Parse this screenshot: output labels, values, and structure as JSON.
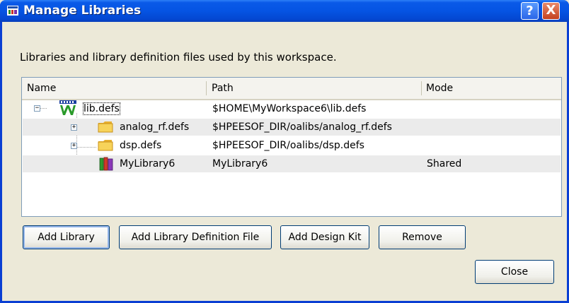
{
  "window": {
    "title": "Manage Libraries",
    "help_label": "?",
    "close_label": "X"
  },
  "description": "Libraries and library definition files used by this workspace.",
  "list": {
    "columns": [
      "Name",
      "Path",
      "Mode"
    ],
    "rows": [
      {
        "name": "lib.defs",
        "path": "$HOME\\MyWorkspace6\\lib.defs",
        "mode": "",
        "icon": "workspace-lib-icon",
        "expanded": true
      },
      {
        "name": "analog_rf.defs",
        "path": "$HPEESOF_DIR/oalibs/analog_rf.defs",
        "mode": "",
        "icon": "folder-icon",
        "expanded": false
      },
      {
        "name": "dsp.defs",
        "path": "$HPEESOF_DIR/oalibs/dsp.defs",
        "mode": "",
        "icon": "folder-icon",
        "expanded": false
      },
      {
        "name": "MyLibrary6",
        "path": "MyLibrary6",
        "mode": "Shared",
        "icon": "library-books-icon"
      }
    ]
  },
  "buttons": {
    "add_library": "Add Library",
    "add_library_definition_file": "Add Library Definition File",
    "add_design_kit": "Add Design Kit",
    "remove": "Remove",
    "close": "Close"
  }
}
